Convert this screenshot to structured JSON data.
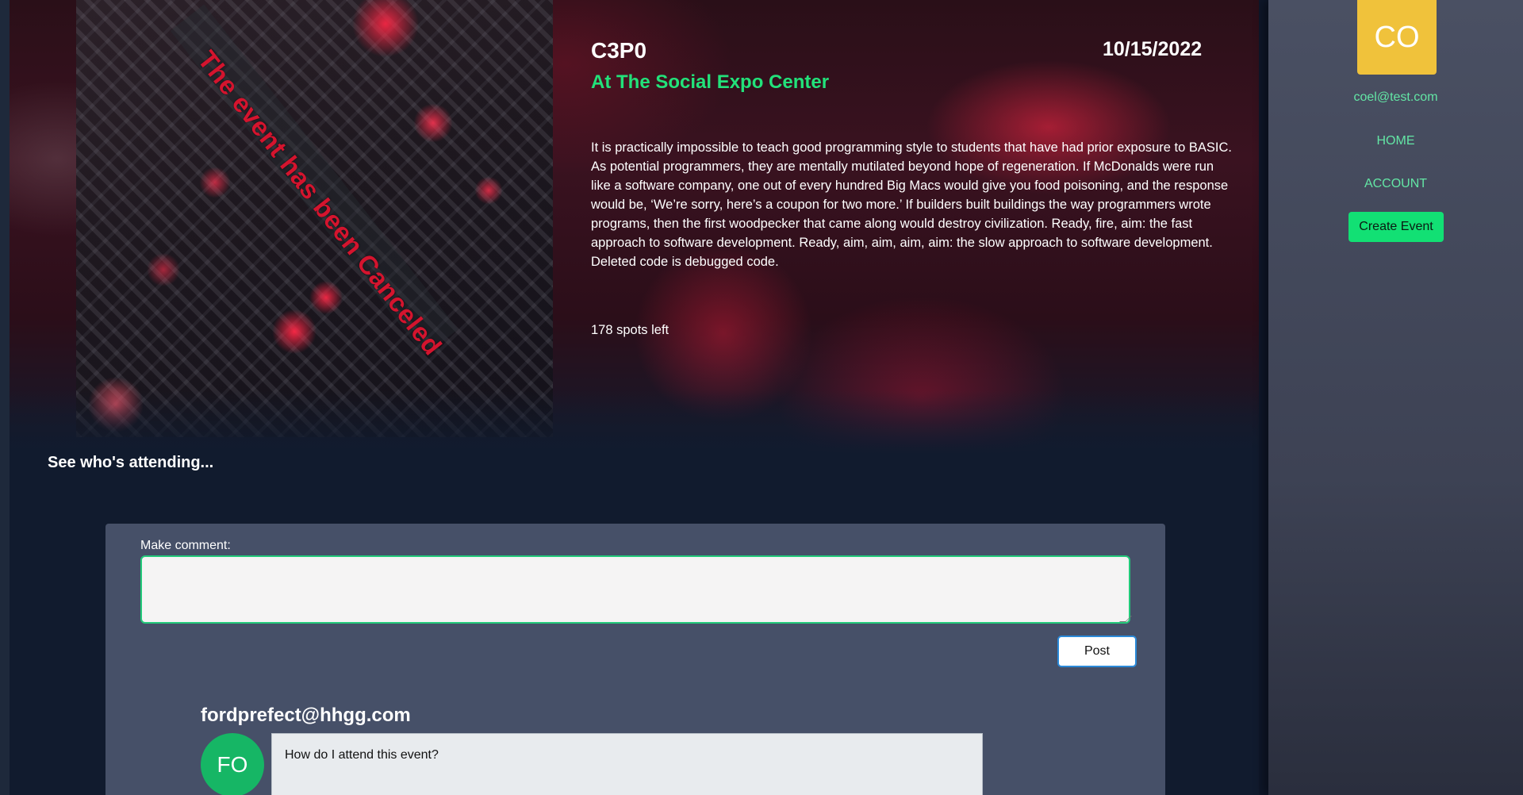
{
  "event": {
    "title": "C3P0",
    "date": "10/15/2022",
    "location": "At The Social Expo Center",
    "description": "It is practically impossible to teach good programming style to students that have had prior exposure to BASIC. As potential programmers, they are mentally mutilated beyond hope of regeneration. If McDonalds were run like a software company, one out of every hundred Big Macs would give you food poisoning, and the response would be, ‘We’re sorry, here’s a coupon for two more.’ If builders built buildings the way programmers wrote programs, then the first woodpecker that came along would destroy civilization. Ready, fire, aim: the fast approach to software development. Ready, aim, aim, aim, aim: the slow approach to software development. Deleted code is debugged code.",
    "spots_left": "178 spots left",
    "canceled_overlay": "The event has been Canceled"
  },
  "attendees": {
    "link_label": "See who's attending..."
  },
  "comment_form": {
    "label": "Make comment:",
    "value": "",
    "post_label": "Post"
  },
  "comments": [
    {
      "author": "fordprefect@hhgg.com",
      "initials": "FO",
      "text": "How do I attend this event?",
      "avatar_color": "#16b665"
    }
  ],
  "sidebar": {
    "avatar_initials": "CO",
    "avatar_color": "#f0c23b",
    "email": "coel@test.com",
    "nav": {
      "home": "HOME",
      "account": "ACCOUNT"
    },
    "create_event_label": "Create Event"
  },
  "colors": {
    "accent_green": "#12e074",
    "link_green": "#63e6a5",
    "cancel_red": "#d4142e"
  }
}
